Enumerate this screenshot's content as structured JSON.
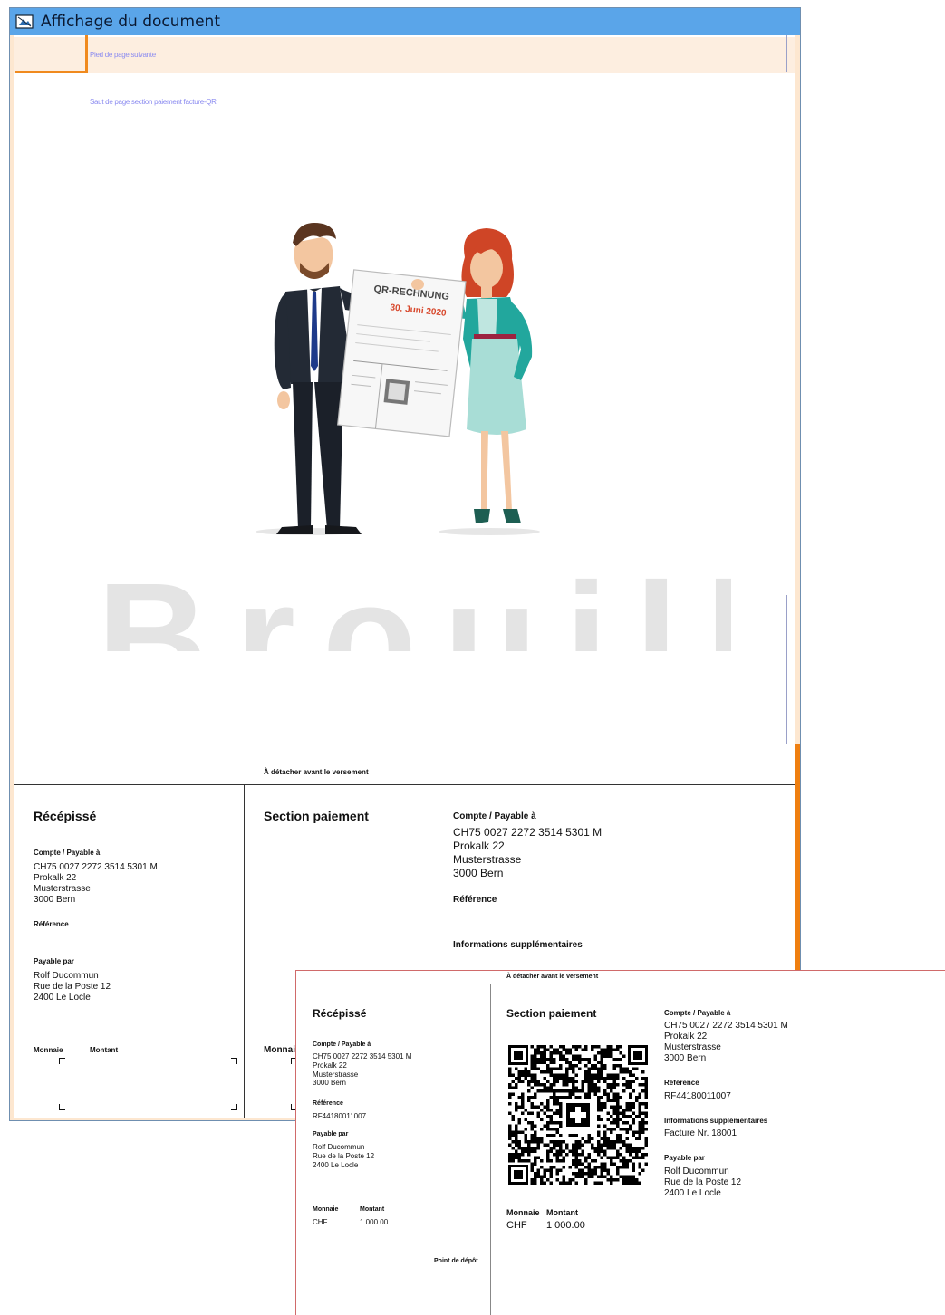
{
  "window": {
    "title": "Affichage du document",
    "footer_next_label": "Pied de page suivante",
    "section_break_label": "Saut de page section paiement facture-QR"
  },
  "watermark": {
    "text": "Brouillon"
  },
  "illustration": {
    "sheet_title": "QR-RECHNUNG",
    "sheet_date": "30. Juni 2020"
  },
  "slip_main": {
    "cut_label": "À détacher avant le versement",
    "receipt": {
      "title": "Récépissé",
      "account_label": "Compte / Payable à",
      "account_lines": [
        "CH75 0027 2272 3514 5301 M",
        "Prokalk 22",
        "Musterstrasse",
        "3000 Bern"
      ],
      "reference_label": "Référence",
      "payable_by_label": "Payable par",
      "payable_by_lines": [
        "Rolf Ducommun",
        "Rue de la Poste 12",
        "2400 Le Locle"
      ],
      "currency_label": "Monnaie",
      "amount_label": "Montant"
    },
    "payment": {
      "title": "Section paiement",
      "currency_label_partial": "Monnai",
      "account_label": "Compte / Payable à",
      "account_lines": [
        "CH75 0027 2272 3514 5301 M",
        "Prokalk 22",
        "Musterstrasse",
        "3000 Bern"
      ],
      "reference_label": "Référence",
      "additional_info_label": "Informations supplémentaires"
    }
  },
  "slip_overlay": {
    "cut_label": "À détacher avant le versement",
    "receipt": {
      "title": "Récépissé",
      "account_label": "Compte / Payable à",
      "account_lines": [
        "CH75 0027 2272 3514 5301 M",
        "Prokalk 22",
        "Musterstrasse",
        "3000 Bern"
      ],
      "reference_label": "Référence",
      "reference_value": "RF44180011007",
      "payable_by_label": "Payable par",
      "payable_by_lines": [
        "Rolf Ducommun",
        "Rue de la Poste 12",
        "2400 Le Locle"
      ],
      "currency_label": "Monnaie",
      "currency_value": "CHF",
      "amount_label": "Montant",
      "amount_value": "1 000.00",
      "deposit_point_label": "Point de dépôt"
    },
    "payment": {
      "title": "Section paiement",
      "account_label": "Compte / Payable à",
      "account_lines": [
        "CH75 0027 2272 3514 5301 M",
        "Prokalk 22",
        "Musterstrasse",
        "3000 Bern"
      ],
      "reference_label": "Référence",
      "reference_value": "RF44180011007",
      "additional_info_label": "Informations supplémentaires",
      "additional_info_value": "Facture Nr. 18001",
      "payable_by_label": "Payable par",
      "payable_by_lines": [
        "Rolf Ducommun",
        "Rue de la Poste 12",
        "2400 Le Locle"
      ],
      "currency_label": "Monnaie",
      "currency_value": "CHF",
      "amount_label": "Montant",
      "amount_value": "1 000.00"
    }
  },
  "colors": {
    "titlebar": "#5aa5e9",
    "accent_orange": "#f08a1e",
    "page_band": "#fdeee0",
    "overlay_border": "#d06a6a"
  }
}
